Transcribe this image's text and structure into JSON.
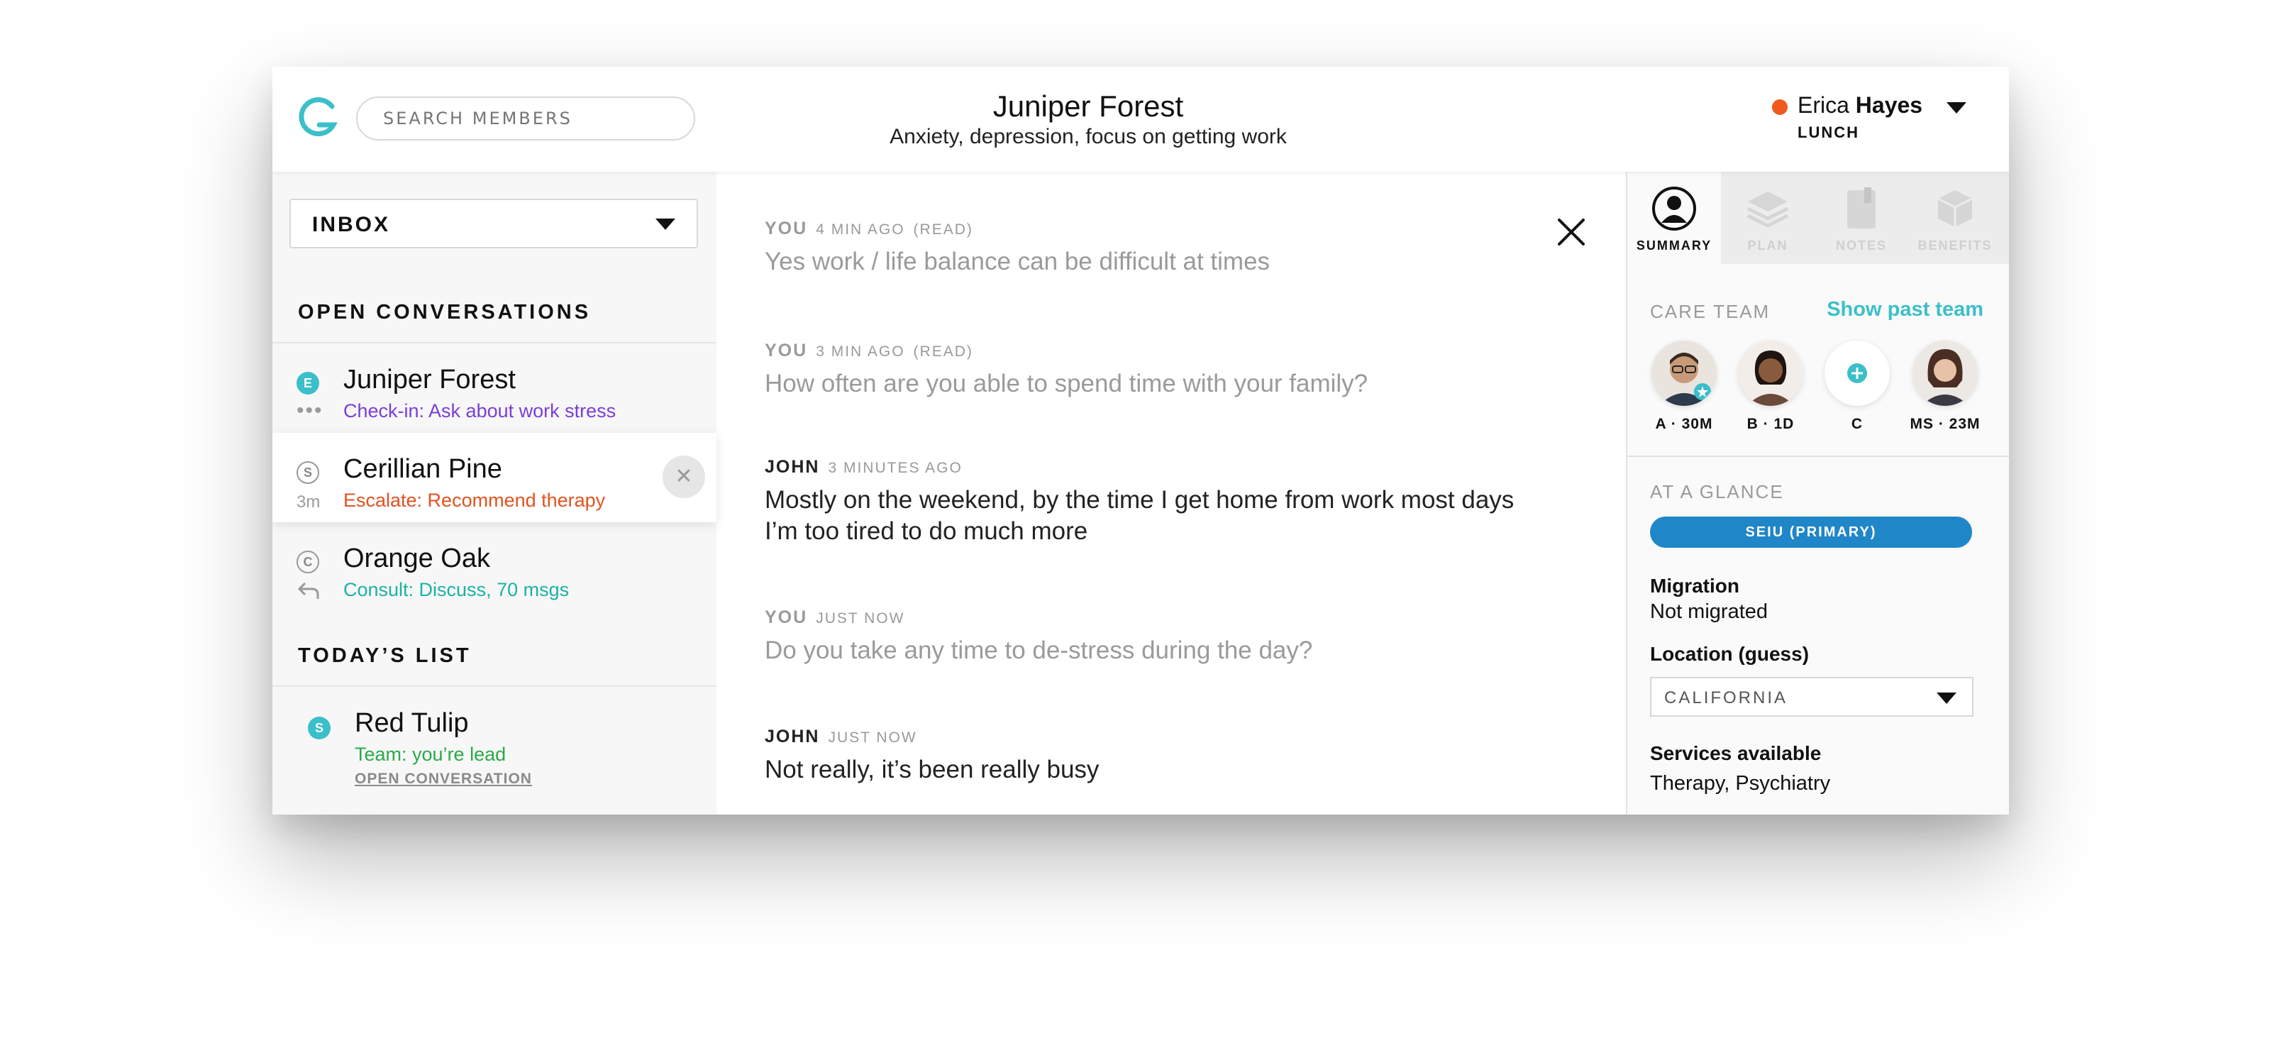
{
  "header": {
    "logo_letter": "G",
    "search_placeholder": "SEARCH MEMBERS",
    "member_name": "Juniper Forest",
    "member_summary": "Anxiety, depression, focus on getting work",
    "user_first": "Erica",
    "user_last": "Hayes",
    "user_status": "LUNCH",
    "status_color": "#f05a1f"
  },
  "left": {
    "inbox_label": "INBOX",
    "open_heading": "OPEN CONVERSATIONS",
    "today_heading": "TODAY’S LIST",
    "conversations": [
      {
        "badge": "E",
        "name": "Juniper Forest",
        "subtitle": "Check-in: Ask about work stress",
        "color": "#7a3fd6"
      },
      {
        "badge": "S",
        "name": "Cerillian Pine",
        "meta": "3m",
        "subtitle": "Escalate: Recommend therapy",
        "color": "#e0531f",
        "close": "✕"
      },
      {
        "badge": "C",
        "name": "Orange Oak",
        "subtitle": "Consult: Discuss, 70 msgs",
        "color": "#1cb2a5"
      }
    ],
    "today": [
      {
        "badge": "S",
        "name": "Red Tulip",
        "subtitle": "Team: you’re lead",
        "color": "#2aaa4a",
        "link": "OPEN CONVERSATION"
      }
    ]
  },
  "messages": [
    {
      "who": "YOU",
      "time": "4 MIN AGO",
      "read": "(READ)",
      "text": "Yes work / life balance can be difficult at times"
    },
    {
      "who": "YOU",
      "time": "3 MIN AGO",
      "read": "(READ)",
      "text": "How often are you able to spend time with your family?"
    },
    {
      "who": "JOHN",
      "time": "3 MINUTES AGO",
      "read": "",
      "text": "Mostly on the weekend, by the time I get home from work most days I’m too tired to do much more"
    },
    {
      "who": "YOU",
      "time": "JUST NOW",
      "read": "",
      "text": "Do you take any time to de-stress during the day?"
    },
    {
      "who": "JOHN",
      "time": "JUST NOW",
      "read": "",
      "text": "Not really, it’s been really busy"
    }
  ],
  "right": {
    "tabs": [
      "SUMMARY",
      "PLAN",
      "NOTES",
      "BENEFITS"
    ],
    "care_team_label": "CARE TEAM",
    "show_past_team": "Show past team",
    "care_team": [
      {
        "label": "A · 30M",
        "icon": "person-glasses-avatar"
      },
      {
        "label": "B · 1D",
        "icon": "person-avatar"
      },
      {
        "label": "C",
        "icon": "plus-icon"
      },
      {
        "label": "MS · 23M",
        "icon": "person-avatar"
      }
    ],
    "at_a_glance_label": "AT A GLANCE",
    "plan_pill": "SEIU (PRIMARY)",
    "migration_label": "Migration",
    "migration_value": "Not migrated",
    "location_label": "Location (guess)",
    "location_value": "CALIFORNIA",
    "services_label": "Services available",
    "services_value": "Therapy, Psychiatry"
  },
  "colors": {
    "accent": "#3bbfc9",
    "pill": "#1f86c8"
  }
}
